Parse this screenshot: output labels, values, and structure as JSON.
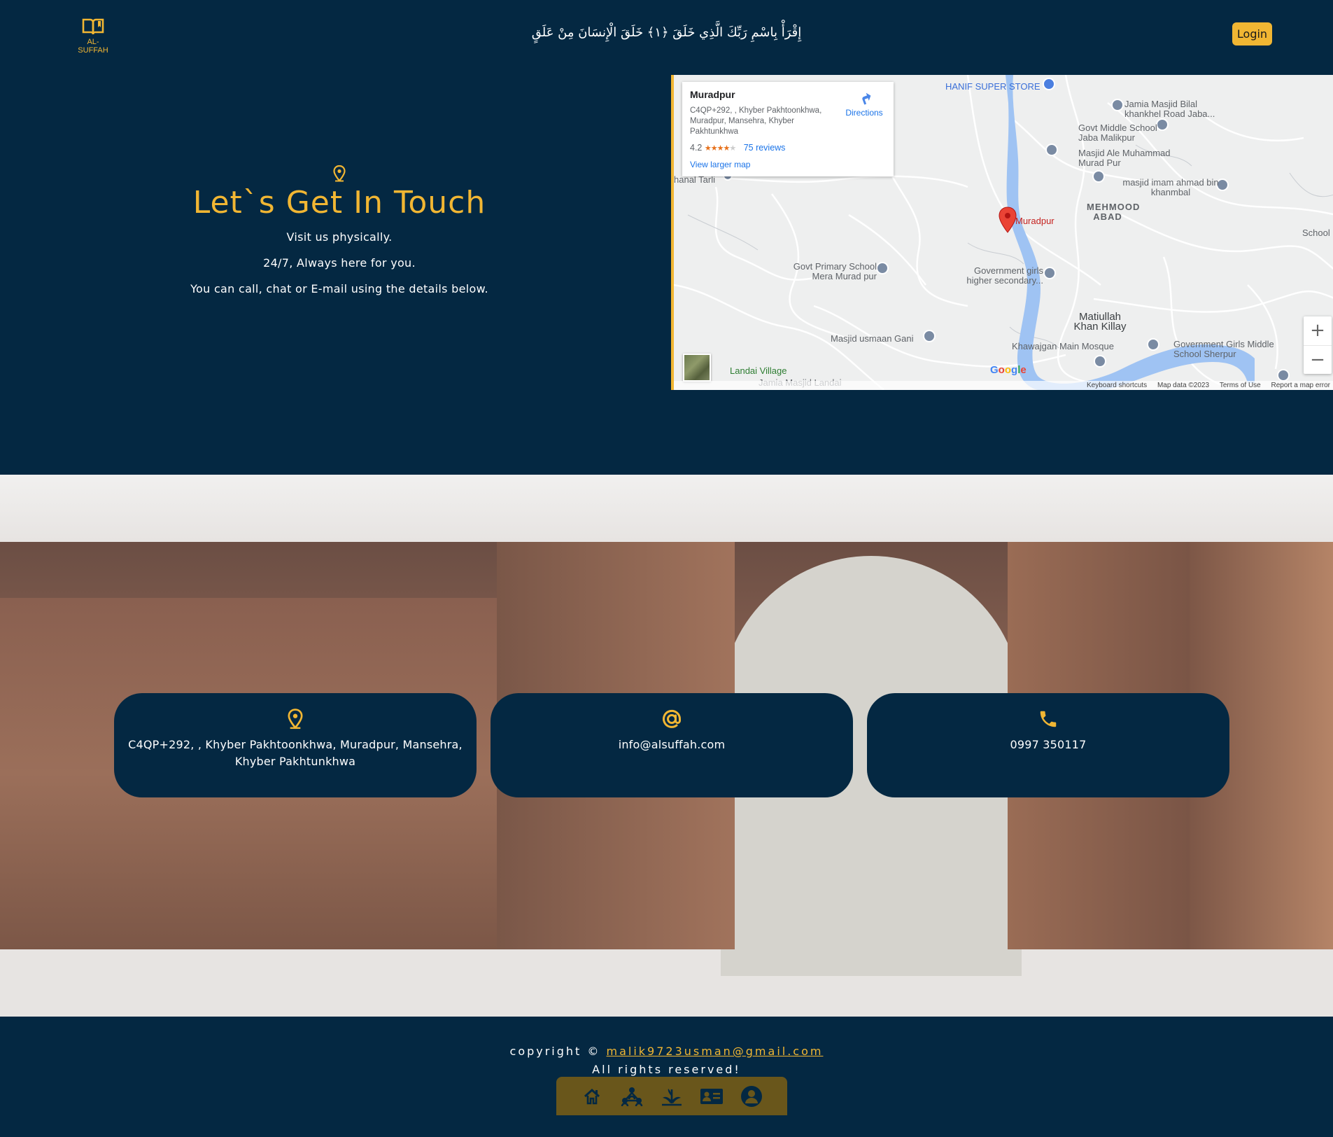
{
  "header": {
    "logo_text": "AL-SUFFAH",
    "verse": "إِقْرَأْ بِاسْمِ رَبِّكَ الَّذِي خَلَقَ ﴿١﴾ خَلَقَ الْإِنسَانَ مِنْ عَلَقٍ",
    "login_label": "Login"
  },
  "hero": {
    "title": "Let`s Get In Touch",
    "line1": "Visit us physically.",
    "line2": "24/7, Always here for you.",
    "line3": "You can call, chat or E-mail using the details below."
  },
  "map": {
    "card_title": "Muradpur",
    "card_address": "C4QP+292, , Khyber Pakhtoonkhwa, Muradpur, Mansehra, Khyber Pakhtunkhwa",
    "rating": "4.2",
    "rating_stars": 4.2,
    "reviews": "75 reviews",
    "view_larger": "View larger map",
    "directions": "Directions",
    "labels": {
      "hanif": "HANIF SUPER STORE",
      "jamia_bilal": "Jamia Masjid Bilal khankhel Road Jaba...",
      "govt_middle": "Govt Middle School Jaba Malikpur",
      "masjid_ale": "Masjid Ale Muhammad Murad Pur",
      "masjid_imam": "masjid imam ahmad bin khanmbal",
      "mehmood": "MEHMOOD ABAD",
      "muradpur_pin": "Muradpur",
      "school": "School",
      "govt_primary": "Govt Primary School Mera Murad pur",
      "govt_girls": "Government girls higher secondary...",
      "matiullah": "Matiullah Khan Killay",
      "masjid_usmaan": "Masjid usmaan Gani",
      "khawajgan": "Khawajgan Main Mosque",
      "govt_girls_middle": "Government Girls Middle School Sherpur",
      "landai": "Landai Village",
      "jamia_landai": "Jamia Masjid Landai",
      "tarli": "hanal Tarli"
    },
    "footer": {
      "shortcuts": "Keyboard shortcuts",
      "map_data": "Map data ©2023",
      "terms": "Terms of Use",
      "report": "Report a map error"
    },
    "zoom_in": "+",
    "zoom_out": "−",
    "google": "Google"
  },
  "contact_cards": [
    {
      "icon": "location-pin-icon",
      "text": "C4QP+292, , Khyber Pakhtoonkhwa, Muradpur, Mansehra, Khyber Pakhtunkhwa"
    },
    {
      "icon": "at-sign-icon",
      "text": "info@alsuffah.com"
    },
    {
      "icon": "phone-icon",
      "text": "0997 350117"
    }
  ],
  "footer": {
    "copyright_prefix": "copyright ©",
    "email": "malik9723usman@gmail.com",
    "rights": "All rights reserved!",
    "nav_icons": [
      "home-icon",
      "community-icon",
      "plant-icon",
      "contact-card-icon",
      "user-icon"
    ]
  },
  "colors": {
    "navy": "#042842",
    "gold": "#f1b633",
    "nav_bar": "#69561b"
  }
}
